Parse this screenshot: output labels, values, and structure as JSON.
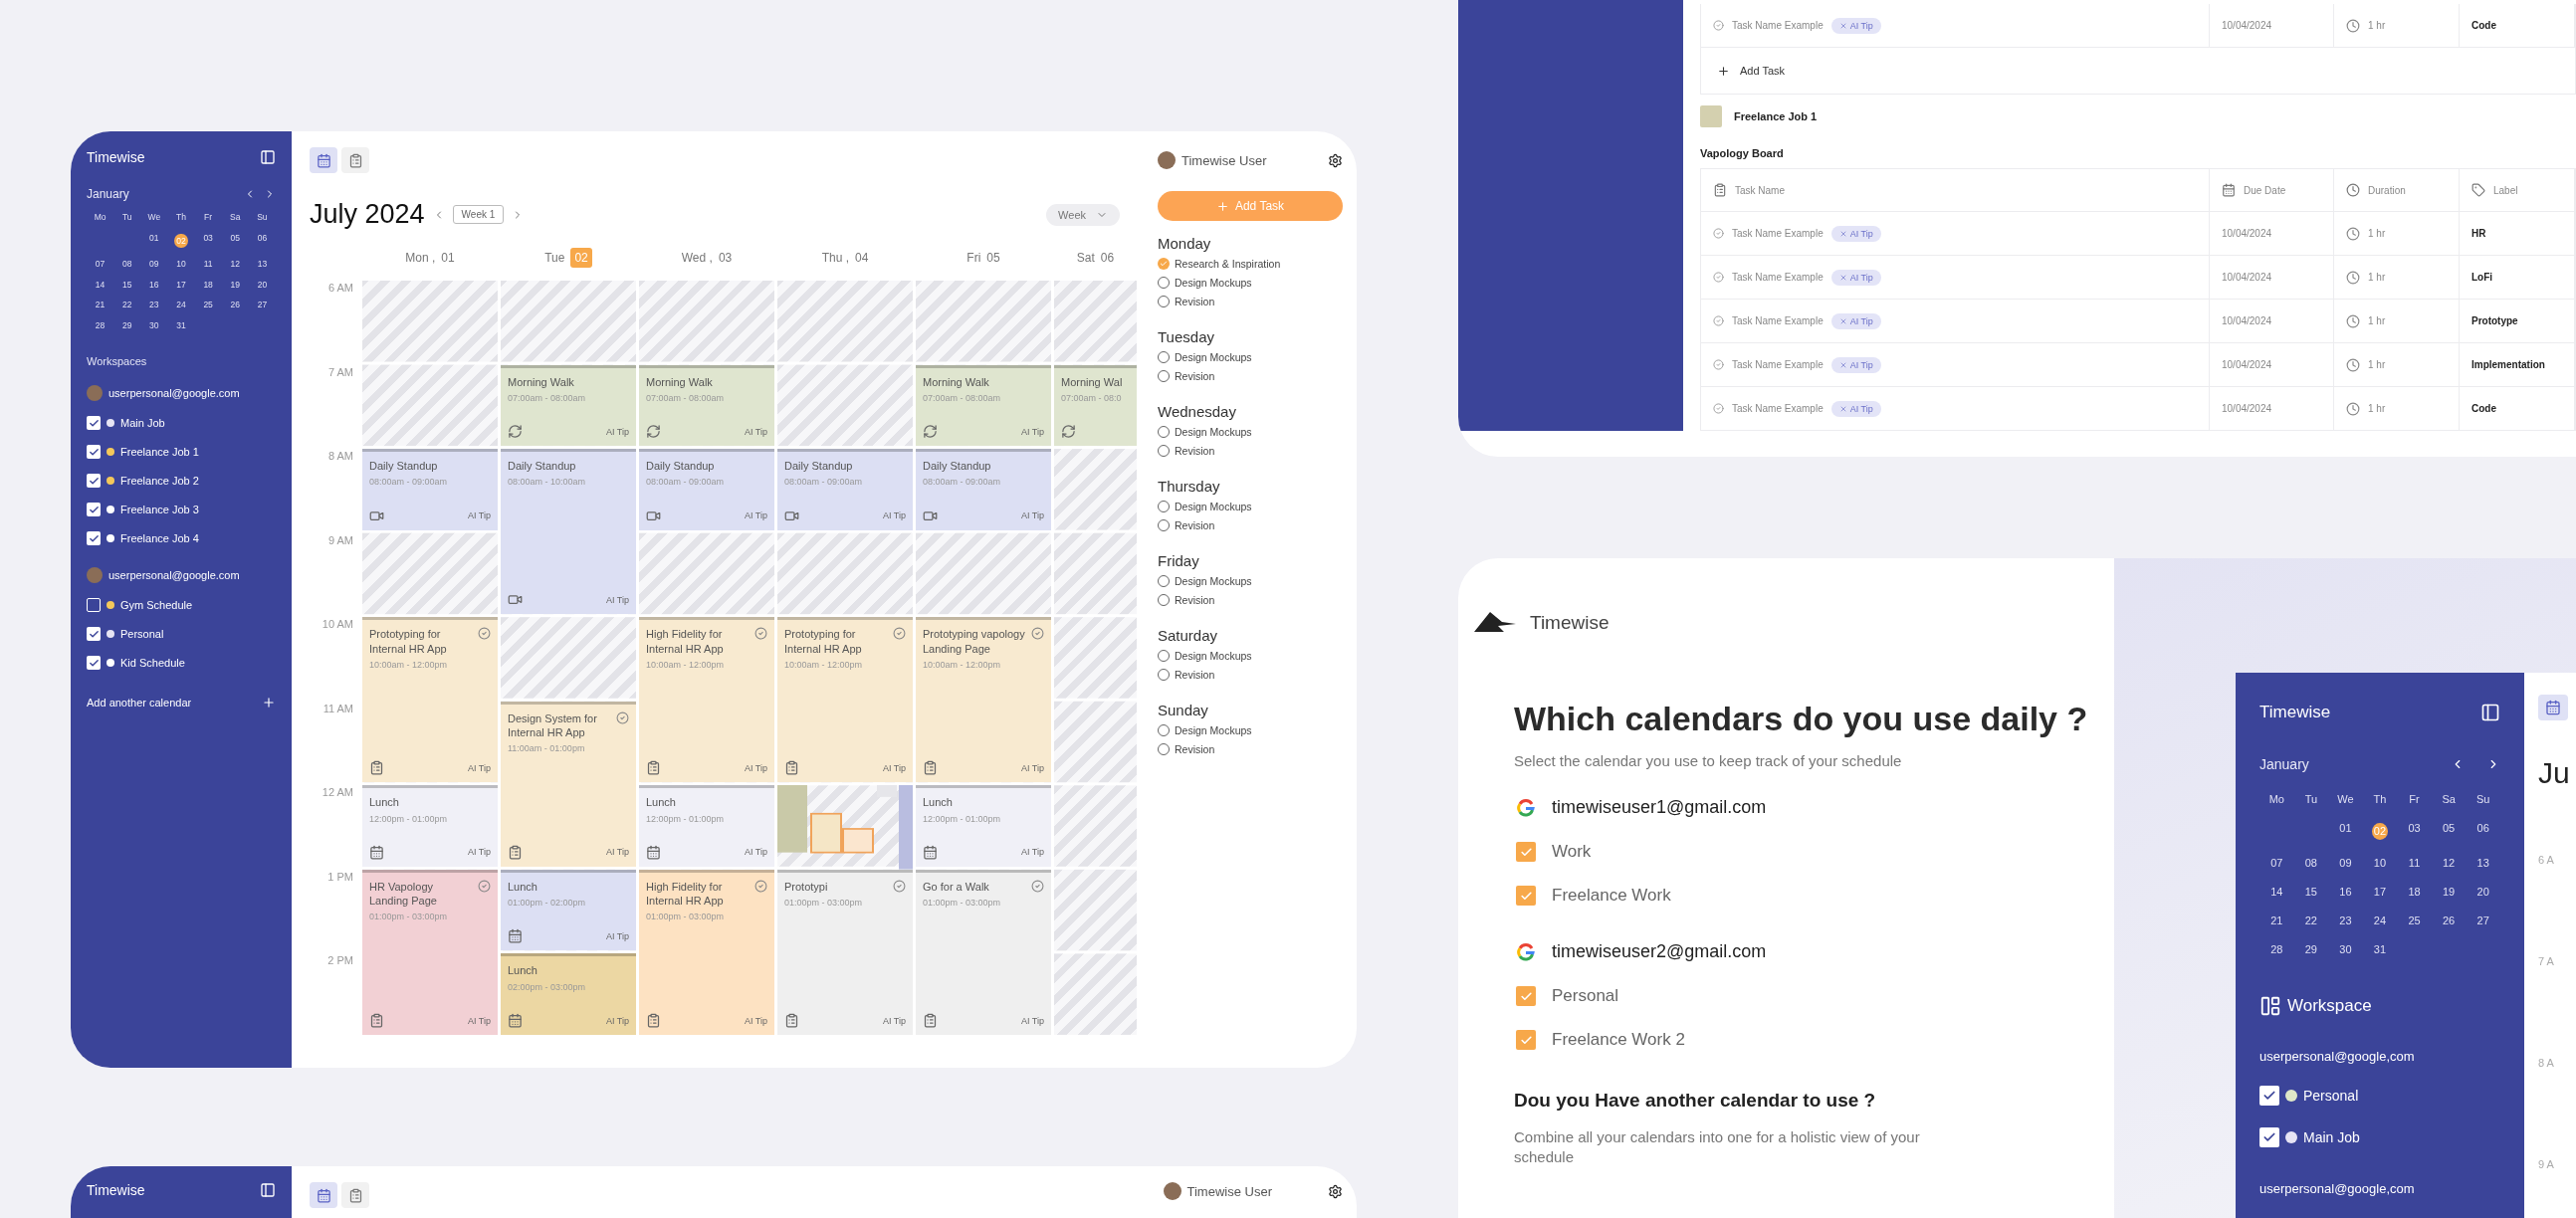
{
  "main_window": {
    "sidebar": {
      "app_name": "Timewise",
      "month": "January",
      "weekdays": [
        "Mo",
        "Tu",
        "We",
        "Th",
        "Fr",
        "Sa",
        "Su"
      ],
      "weeks": [
        [
          {
            "label": "01",
            "selected": false
          },
          {
            "label": "02",
            "selected": true
          },
          {
            "label": "03",
            "selected": false
          },
          {
            "label": "05",
            "selected": false
          },
          {
            "label": "06",
            "selected": false
          }
        ],
        [
          {
            "label": "07",
            "selected": false
          },
          {
            "label": "08",
            "selected": false
          },
          {
            "label": "09",
            "selected": false
          },
          {
            "label": "10",
            "selected": false
          },
          {
            "label": "11",
            "selected": false
          },
          {
            "label": "12",
            "selected": false
          },
          {
            "label": "13",
            "selected": false
          }
        ],
        [
          {
            "label": "14",
            "selected": false
          },
          {
            "label": "15",
            "selected": false
          },
          {
            "label": "16",
            "selected": false
          },
          {
            "label": "17",
            "selected": false
          },
          {
            "label": "18",
            "selected": false
          },
          {
            "label": "19",
            "selected": false
          },
          {
            "label": "20",
            "selected": false
          }
        ],
        [
          {
            "label": "21",
            "selected": false
          },
          {
            "label": "22",
            "selected": false
          },
          {
            "label": "23",
            "selected": false
          },
          {
            "label": "24",
            "selected": false
          },
          {
            "label": "25",
            "selected": false
          },
          {
            "label": "26",
            "selected": false
          },
          {
            "label": "27",
            "selected": false
          }
        ],
        [
          {
            "label": "28",
            "selected": false
          },
          {
            "label": "29",
            "selected": false
          },
          {
            "label": "30",
            "selected": false
          },
          {
            "label": "31",
            "selected": false
          }
        ]
      ],
      "workspaces_label": "Workspaces",
      "accounts": [
        {
          "email": "userpersonal@google.com",
          "calendars": [
            {
              "name": "Main Job",
              "checked": true,
              "color": "#e6e4f4"
            },
            {
              "name": "Freelance Job 1",
              "checked": true,
              "color": "#f4c85a"
            },
            {
              "name": "Freelance Job 2",
              "checked": true,
              "color": "#f4c85a"
            },
            {
              "name": "Freelance Job 3",
              "checked": true,
              "color": "#ffffff"
            },
            {
              "name": "Freelance Job 4",
              "checked": true,
              "color": "#ffffff"
            }
          ]
        },
        {
          "email": "userpersonal@google.com",
          "calendars": [
            {
              "name": "Gym Schedule",
              "checked": false,
              "color": "#f4c85a"
            },
            {
              "name": "Personal",
              "checked": true,
              "color": "#e6e4f4"
            },
            {
              "name": "Kid Schedule",
              "checked": true,
              "color": "#ffffff"
            }
          ]
        }
      ],
      "add_calendar": "Add another calendar"
    },
    "views": [
      {
        "kind": "calendar",
        "selected": true
      },
      {
        "kind": "tasks",
        "selected": false
      }
    ],
    "title": "July 2024",
    "week": "Week 1",
    "view_select": "Week",
    "hours": [
      "6 AM",
      "7 AM",
      "8 AM",
      "9 AM",
      "10 AM",
      "11 AM",
      "12 AM",
      "1 PM",
      "2 PM"
    ],
    "days": [
      {
        "name": "Mon ,",
        "date": "01",
        "today": false,
        "busy_cluster": false,
        "events": [
          {
            "kind": "meeting",
            "title": "Daily Standup",
            "time": "08:00am - 09:00am",
            "tag": "AI Tip",
            "color": "#dcdff3"
          },
          {
            "kind": "task",
            "title": "Prototyping for Internal HR App",
            "time": "10:00am - 12:00pm",
            "tag": "AI Tip",
            "color": "#f8ead0"
          },
          {
            "kind": "break",
            "title": "Lunch",
            "time": "12:00pm - 01:00pm",
            "tag": "AI Tip",
            "color": "#f0f0f7"
          },
          {
            "kind": "task",
            "title": "HR Vapology Landing Page",
            "time": "01:00pm - 03:00pm",
            "tag": "AI Tip",
            "color": "#f2d0d4"
          }
        ]
      },
      {
        "name": "Tue",
        "date": "02",
        "today": true,
        "busy_cluster": false,
        "events": [
          {
            "kind": "routine",
            "title": "Morning Walk",
            "time": "07:00am - 08:00am",
            "tag": "AI Tip",
            "color": "#dfe5cf"
          },
          {
            "kind": "meeting",
            "title": "Daily Standup",
            "time": "08:00am - 10:00am",
            "tag": "AI Tip",
            "color": "#dcdff3"
          },
          {
            "kind": "task",
            "title": "Design System for Internal HR App",
            "time": "11:00am - 01:00pm",
            "tag": "AI Tip",
            "color": "#f8ead0"
          },
          {
            "kind": "break",
            "title": "Lunch",
            "time": "01:00pm - 02:00pm",
            "tag": "AI Tip",
            "color": "#dcdff3"
          },
          {
            "kind": "break",
            "title": "Lunch",
            "time": "02:00pm - 03:00pm",
            "tag": "AI Tip",
            "color": "#ecd7a3"
          }
        ]
      },
      {
        "name": "Wed ,",
        "date": "03",
        "today": false,
        "busy_cluster": false,
        "events": [
          {
            "kind": "routine",
            "title": "Morning Walk",
            "time": "07:00am - 08:00am",
            "tag": "AI Tip",
            "color": "#dfe5cf"
          },
          {
            "kind": "meeting",
            "title": "Daily Standup",
            "time": "08:00am - 09:00am",
            "tag": "AI Tip",
            "color": "#dcdff3"
          },
          {
            "kind": "task",
            "title": "High Fidelity for Internal HR App",
            "time": "10:00am - 12:00pm",
            "tag": "AI Tip",
            "color": "#f8ead0"
          },
          {
            "kind": "break",
            "title": "Lunch",
            "time": "12:00pm - 01:00pm",
            "tag": "AI Tip",
            "color": "#f0f0f7"
          },
          {
            "kind": "task",
            "title": "High Fidelity for Internal HR App",
            "time": "01:00pm - 03:00pm",
            "tag": "AI Tip",
            "color": "#fde2c2"
          }
        ]
      },
      {
        "name": "Thu ,",
        "date": "04",
        "today": false,
        "busy_cluster": true,
        "events": [
          {
            "kind": "meeting",
            "title": "Daily Standup",
            "time": "08:00am - 09:00am",
            "tag": "AI Tip",
            "color": "#dcdff3"
          },
          {
            "kind": "task",
            "title": "Prototyping for Internal HR App",
            "time": "10:00am - 12:00pm",
            "tag": "AI Tip",
            "color": "#f8ead0"
          },
          {
            "kind": "task",
            "title": "Prototypi",
            "time": "01:00pm - 03:00pm",
            "tag": "AI Tip",
            "color": "#efefef"
          }
        ]
      },
      {
        "name": "Fri",
        "date": "05",
        "today": false,
        "busy_cluster": false,
        "events": [
          {
            "kind": "routine",
            "title": "Morning Walk",
            "time": "07:00am - 08:00am",
            "tag": "AI Tip",
            "color": "#dfe5cf"
          },
          {
            "kind": "meeting",
            "title": "Daily Standup",
            "time": "08:00am - 09:00am",
            "tag": "AI Tip",
            "color": "#dcdff3"
          },
          {
            "kind": "task",
            "title": "Prototyping vapology Landing Page",
            "time": "10:00am - 12:00pm",
            "tag": "AI Tip",
            "color": "#f8ead0"
          },
          {
            "kind": "break",
            "title": "Lunch",
            "time": "12:00pm - 01:00pm",
            "tag": "AI Tip",
            "color": "#f0f0f7"
          },
          {
            "kind": "task",
            "title": "Go for a Walk",
            "time": "01:00pm - 03:00pm",
            "tag": "AI Tip",
            "color": "#efefef"
          }
        ]
      },
      {
        "name": "Sat",
        "date": "06",
        "today": false,
        "busy_cluster": false,
        "events": [
          {
            "kind": "routine",
            "title": "Morning Wal",
            "time": "07:00am - 08:0",
            "color": "#dfe5cf"
          }
        ]
      }
    ],
    "agenda": {
      "user": "Timewise User",
      "add_button": "Add Task",
      "days": [
        {
          "name": "Monday",
          "tasks": [
            {
              "title": "Research & Inspiration",
              "checked": true
            },
            {
              "title": "Design Mockups",
              "checked": false
            },
            {
              "title": "Revision",
              "checked": false
            }
          ]
        },
        {
          "name": "Tuesday",
          "tasks": [
            {
              "title": "Design Mockups",
              "checked": false
            },
            {
              "title": "Revision",
              "checked": false
            }
          ]
        },
        {
          "name": "Wednesday",
          "tasks": [
            {
              "title": "Design Mockups",
              "checked": false
            },
            {
              "title": "Revision",
              "checked": false
            }
          ]
        },
        {
          "name": "Thursday",
          "tasks": [
            {
              "title": "Design Mockups",
              "checked": false
            },
            {
              "title": "Revision",
              "checked": false
            }
          ]
        },
        {
          "name": "Friday",
          "tasks": [
            {
              "title": "Design Mockups",
              "checked": false
            },
            {
              "title": "Revision",
              "checked": false
            }
          ]
        },
        {
          "name": "Saturday",
          "tasks": [
            {
              "title": "Design Mockups",
              "checked": false
            },
            {
              "title": "Revision",
              "checked": false
            }
          ]
        },
        {
          "name": "Sunday",
          "tasks": [
            {
              "title": "Design Mockups",
              "checked": false
            },
            {
              "title": "Revision",
              "checked": false
            }
          ]
        }
      ]
    }
  },
  "task_window": {
    "previous_row": {
      "task": "Task Name Example",
      "tag": "AI Tip",
      "due": "10/04/2024",
      "duration": "1 hr",
      "label": "Code"
    },
    "add_task": "Add Task",
    "group": {
      "name": "Freelance Job 1",
      "color": "#d4d0af"
    },
    "board": "Vapology Board",
    "columns": [
      "Task Name",
      "Due Date",
      "Duration",
      "Label"
    ],
    "rows": [
      {
        "task": "Task Name Example",
        "tag": "AI Tip",
        "due": "10/04/2024",
        "duration": "1 hr",
        "label": "HR"
      },
      {
        "task": "Task Name Example",
        "tag": "AI Tip",
        "due": "10/04/2024",
        "duration": "1 hr",
        "label": "LoFi"
      },
      {
        "task": "Task Name Example",
        "tag": "AI Tip",
        "due": "10/04/2024",
        "duration": "1 hr",
        "label": "Prototype"
      },
      {
        "task": "Task Name Example",
        "tag": "AI Tip",
        "due": "10/04/2024",
        "duration": "1 hr",
        "label": "Implementation"
      },
      {
        "task": "Task Name Example",
        "tag": "AI Tip",
        "due": "10/04/2024",
        "duration": "1 hr",
        "label": "Code"
      }
    ]
  },
  "onboarding": {
    "brand": "Timewise",
    "heading": "Which calendars do you use daily ?",
    "subheading": "Select the calendar you use to keep track of your schedule",
    "accounts": [
      {
        "email": "timewiseuser1@gmail.com",
        "calendars": [
          {
            "name": "Work",
            "checked": true
          },
          {
            "name": "Freelance Work",
            "checked": true
          }
        ]
      },
      {
        "email": "timewiseuser2@gmail.com",
        "calendars": [
          {
            "name": "Personal",
            "checked": true
          },
          {
            "name": "Freelance Work 2",
            "checked": true
          }
        ]
      }
    ],
    "question": "Dou you Have another calendar to use ?",
    "note": "Combine all your calendars into one for a holistic view of your schedule",
    "preview": {
      "app_name": "Timewise",
      "month": "January",
      "weekdays": [
        "Mo",
        "Tu",
        "We",
        "Th",
        "Fr",
        "Sa",
        "Su"
      ],
      "weeks": [
        [
          {
            "label": "01",
            "selected": false
          },
          {
            "label": "02",
            "selected": true
          },
          {
            "label": "03",
            "selected": false
          },
          {
            "label": "05",
            "selected": false
          },
          {
            "label": "06",
            "selected": false
          }
        ],
        [
          {
            "label": "07",
            "selected": false
          },
          {
            "label": "08",
            "selected": false
          },
          {
            "label": "09",
            "selected": false
          },
          {
            "label": "10",
            "selected": false
          },
          {
            "label": "11",
            "selected": false
          },
          {
            "label": "12",
            "selected": false
          },
          {
            "label": "13",
            "selected": false
          }
        ],
        [
          {
            "label": "14",
            "selected": false
          },
          {
            "label": "15",
            "selected": false
          },
          {
            "label": "16",
            "selected": false
          },
          {
            "label": "17",
            "selected": false
          },
          {
            "label": "18",
            "selected": false
          },
          {
            "label": "19",
            "selected": false
          },
          {
            "label": "20",
            "selected": false
          }
        ],
        [
          {
            "label": "21",
            "selected": false
          },
          {
            "label": "22",
            "selected": false
          },
          {
            "label": "23",
            "selected": false
          },
          {
            "label": "24",
            "selected": false
          },
          {
            "label": "25",
            "selected": false
          },
          {
            "label": "26",
            "selected": false
          },
          {
            "label": "27",
            "selected": false
          }
        ],
        [
          {
            "label": "28",
            "selected": false
          },
          {
            "label": "29",
            "selected": false
          },
          {
            "label": "30",
            "selected": false
          },
          {
            "label": "31",
            "selected": false
          }
        ]
      ],
      "workspace_label": "Workspace",
      "accounts": [
        {
          "email": "userpersonal@google,com",
          "calendars": [
            {
              "name": "Personal",
              "checked": true,
              "color": "#dfe8c8"
            },
            {
              "name": "Main Job",
              "checked": true,
              "color": "#e6e4f4"
            }
          ]
        },
        {
          "email": "userpersonal@google,com"
        }
      ],
      "title_fragment": "Ju",
      "hours": [
        "6 A",
        "7 A",
        "8 A",
        "9 A"
      ]
    }
  },
  "bottom_window": {
    "app_name": "Timewise",
    "user": "Timewise User",
    "views": [
      {
        "kind": "calendar",
        "selected": true
      },
      {
        "kind": "tasks",
        "selected": false
      }
    ]
  }
}
